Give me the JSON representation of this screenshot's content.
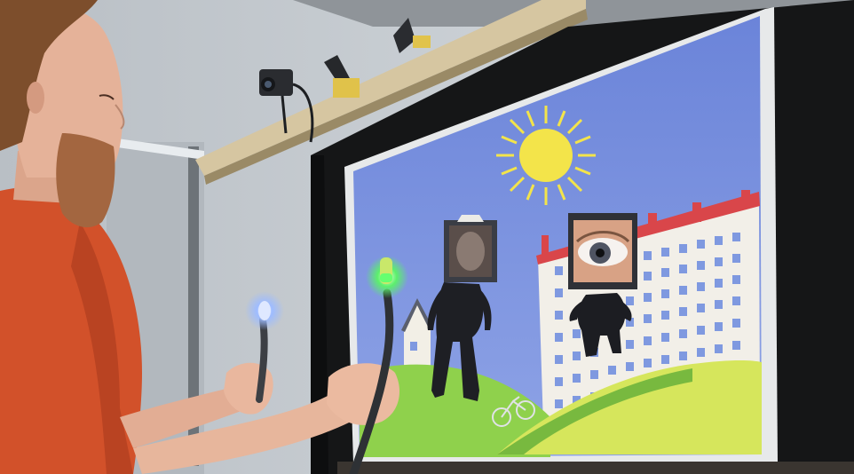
{
  "scene": {
    "colors": {
      "wall": "#c9ced3",
      "screen_sky": "#6f86d8",
      "sun": "#f0e24a",
      "building": "#f1eee6",
      "roof": "#d8474a",
      "window": "#7f9ae0",
      "hill_green": "#8fcf4a",
      "hill_yellow": "#d7e65b",
      "shirt": "#d7532a",
      "skin": "#e7b69c",
      "beard": "#a5673f",
      "controller_glow_blue": "#8fb7ff",
      "controller_glow_green": "#6cff7a"
    }
  }
}
